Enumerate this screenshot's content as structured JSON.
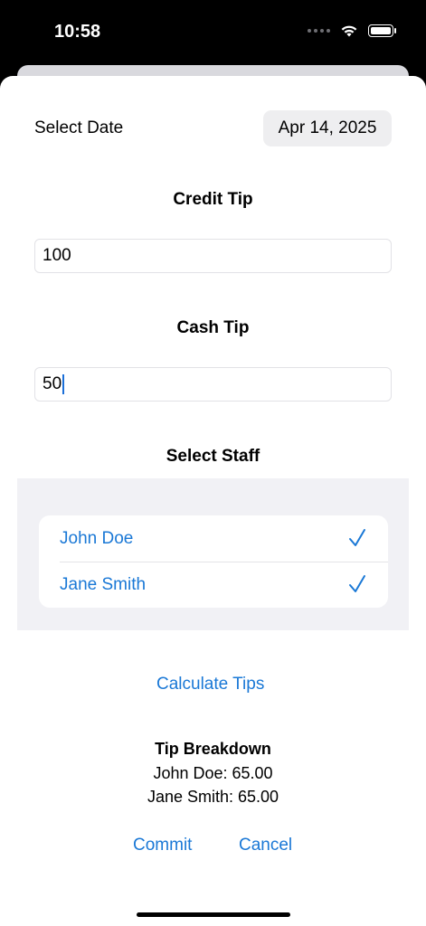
{
  "status_bar": {
    "time": "10:58"
  },
  "date": {
    "label": "Select Date",
    "value": "Apr 14, 2025"
  },
  "credit_tip": {
    "title": "Credit Tip",
    "value": "100"
  },
  "cash_tip": {
    "title": "Cash Tip",
    "value": "50"
  },
  "staff": {
    "title": "Select Staff",
    "items": [
      {
        "name": "John Doe",
        "selected": true
      },
      {
        "name": "Jane Smith",
        "selected": true
      }
    ]
  },
  "calculate_label": "Calculate Tips",
  "breakdown": {
    "title": "Tip Breakdown",
    "lines": [
      "John Doe: 65.00",
      "Jane Smith: 65.00"
    ]
  },
  "actions": {
    "commit_label": "Commit",
    "cancel_label": "Cancel"
  },
  "colors": {
    "accent": "#1a78d6",
    "field_bg": "#eeeef0",
    "list_bg": "#f1f1f5"
  }
}
